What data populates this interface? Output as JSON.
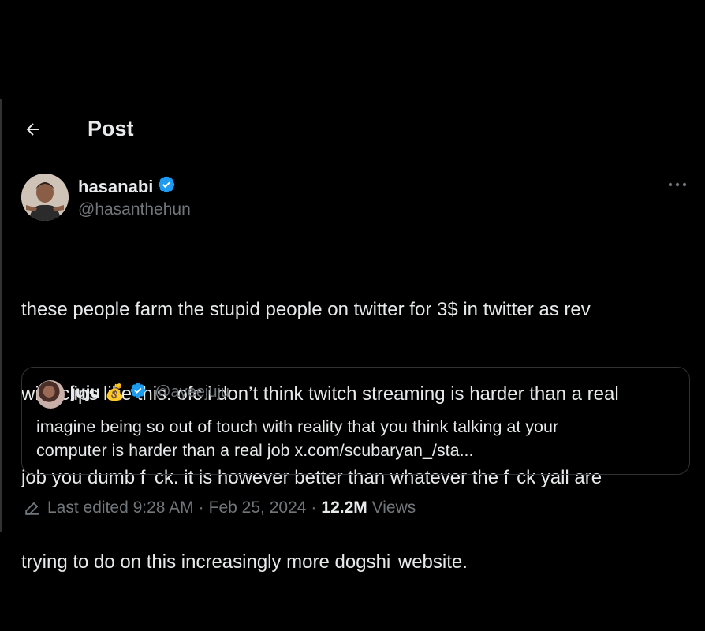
{
  "header": {
    "title": "Post",
    "back_icon": "arrow-left-icon"
  },
  "author": {
    "display_name": "hasanabi",
    "handle": "@hasanthehun",
    "verified_icon": "verified-badge-icon",
    "verified_color": "#1d9bf0"
  },
  "tweet": {
    "lines": [
      "these people farm the stupid people on twitter for 3$ in twitter as rev",
      "with clips like this. ofc i don’t think twitch streaming is harder than a real",
      "job you dumb f  ck. it is however better than whatever the f  ck yall are",
      "trying to do on this increasingly more dogshi  website."
    ]
  },
  "quote": {
    "display_name": "juju",
    "emoji": "💰",
    "handle": "@ayeejuju",
    "text_line1": "imagine being so out of touch with reality that you think talking at your",
    "text_line2": "computer is harder than a real job x.com/scubaryan_/sta..."
  },
  "meta": {
    "edit_icon": "pencil-icon",
    "edited_label": "Last edited",
    "time": "9:28 AM",
    "separator": "·",
    "date": "Feb 25, 2024",
    "views_count": "12.2M",
    "views_label": "Views"
  },
  "colors": {
    "background": "#000000",
    "text_primary": "#e7e9ea",
    "text_secondary": "#71767b",
    "border": "#2f3336",
    "verified": "#1d9bf0"
  }
}
